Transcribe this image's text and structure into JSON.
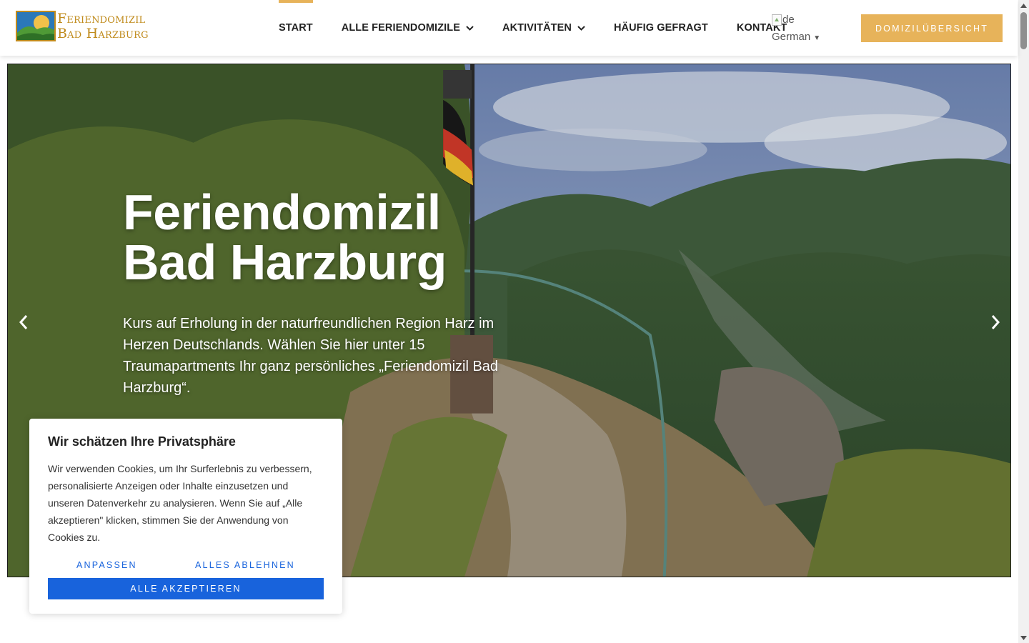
{
  "header": {
    "logo": {
      "line1": "Feriendomizil",
      "line2": "Bad Harzburg"
    },
    "nav": [
      {
        "label": "Start",
        "active": true,
        "has_dropdown": false
      },
      {
        "label": "Alle Feriendomizile",
        "active": false,
        "has_dropdown": true
      },
      {
        "label": "Aktivitäten",
        "active": false,
        "has_dropdown": true
      },
      {
        "label": "Häufig gefragt",
        "active": false,
        "has_dropdown": false
      },
      {
        "label": "Kontakt",
        "active": false,
        "has_dropdown": false
      }
    ],
    "language": {
      "flag_alt": "de",
      "label": "German",
      "caret": "▼"
    },
    "cta_label": "Domizilübersicht"
  },
  "hero": {
    "title_line1": "Feriendomizil",
    "title_line2": "Bad Harzburg",
    "text": "Kurs auf Erholung in der naturfreundlichen Region Harz im Herzen Deutschlands. Wählen Sie hier unter 15 Traumapartments Ihr ganz persönliches „Feriendomizil Bad Harzburg“.",
    "prev_icon": "chevron-left-icon",
    "next_icon": "chevron-right-icon"
  },
  "cookie_banner": {
    "title": "Wir schätzen Ihre Privatsphäre",
    "text": "Wir verwenden Cookies, um Ihr Surferlebnis zu verbessern, personalisierte Anzeigen oder Inhalte einzusetzen und unseren Datenverkehr zu analysieren. Wenn Sie auf „Alle akzeptieren\" klicken, stimmen Sie der Anwendung von Cookies zu.",
    "customize_label": "Anpassen",
    "reject_label": "Alles ablehnen",
    "accept_label": "Alle akzeptieren"
  },
  "colors": {
    "accent": "#e7b35a",
    "logo_text": "#c08b1c",
    "cookie_button": "#1863dc"
  }
}
